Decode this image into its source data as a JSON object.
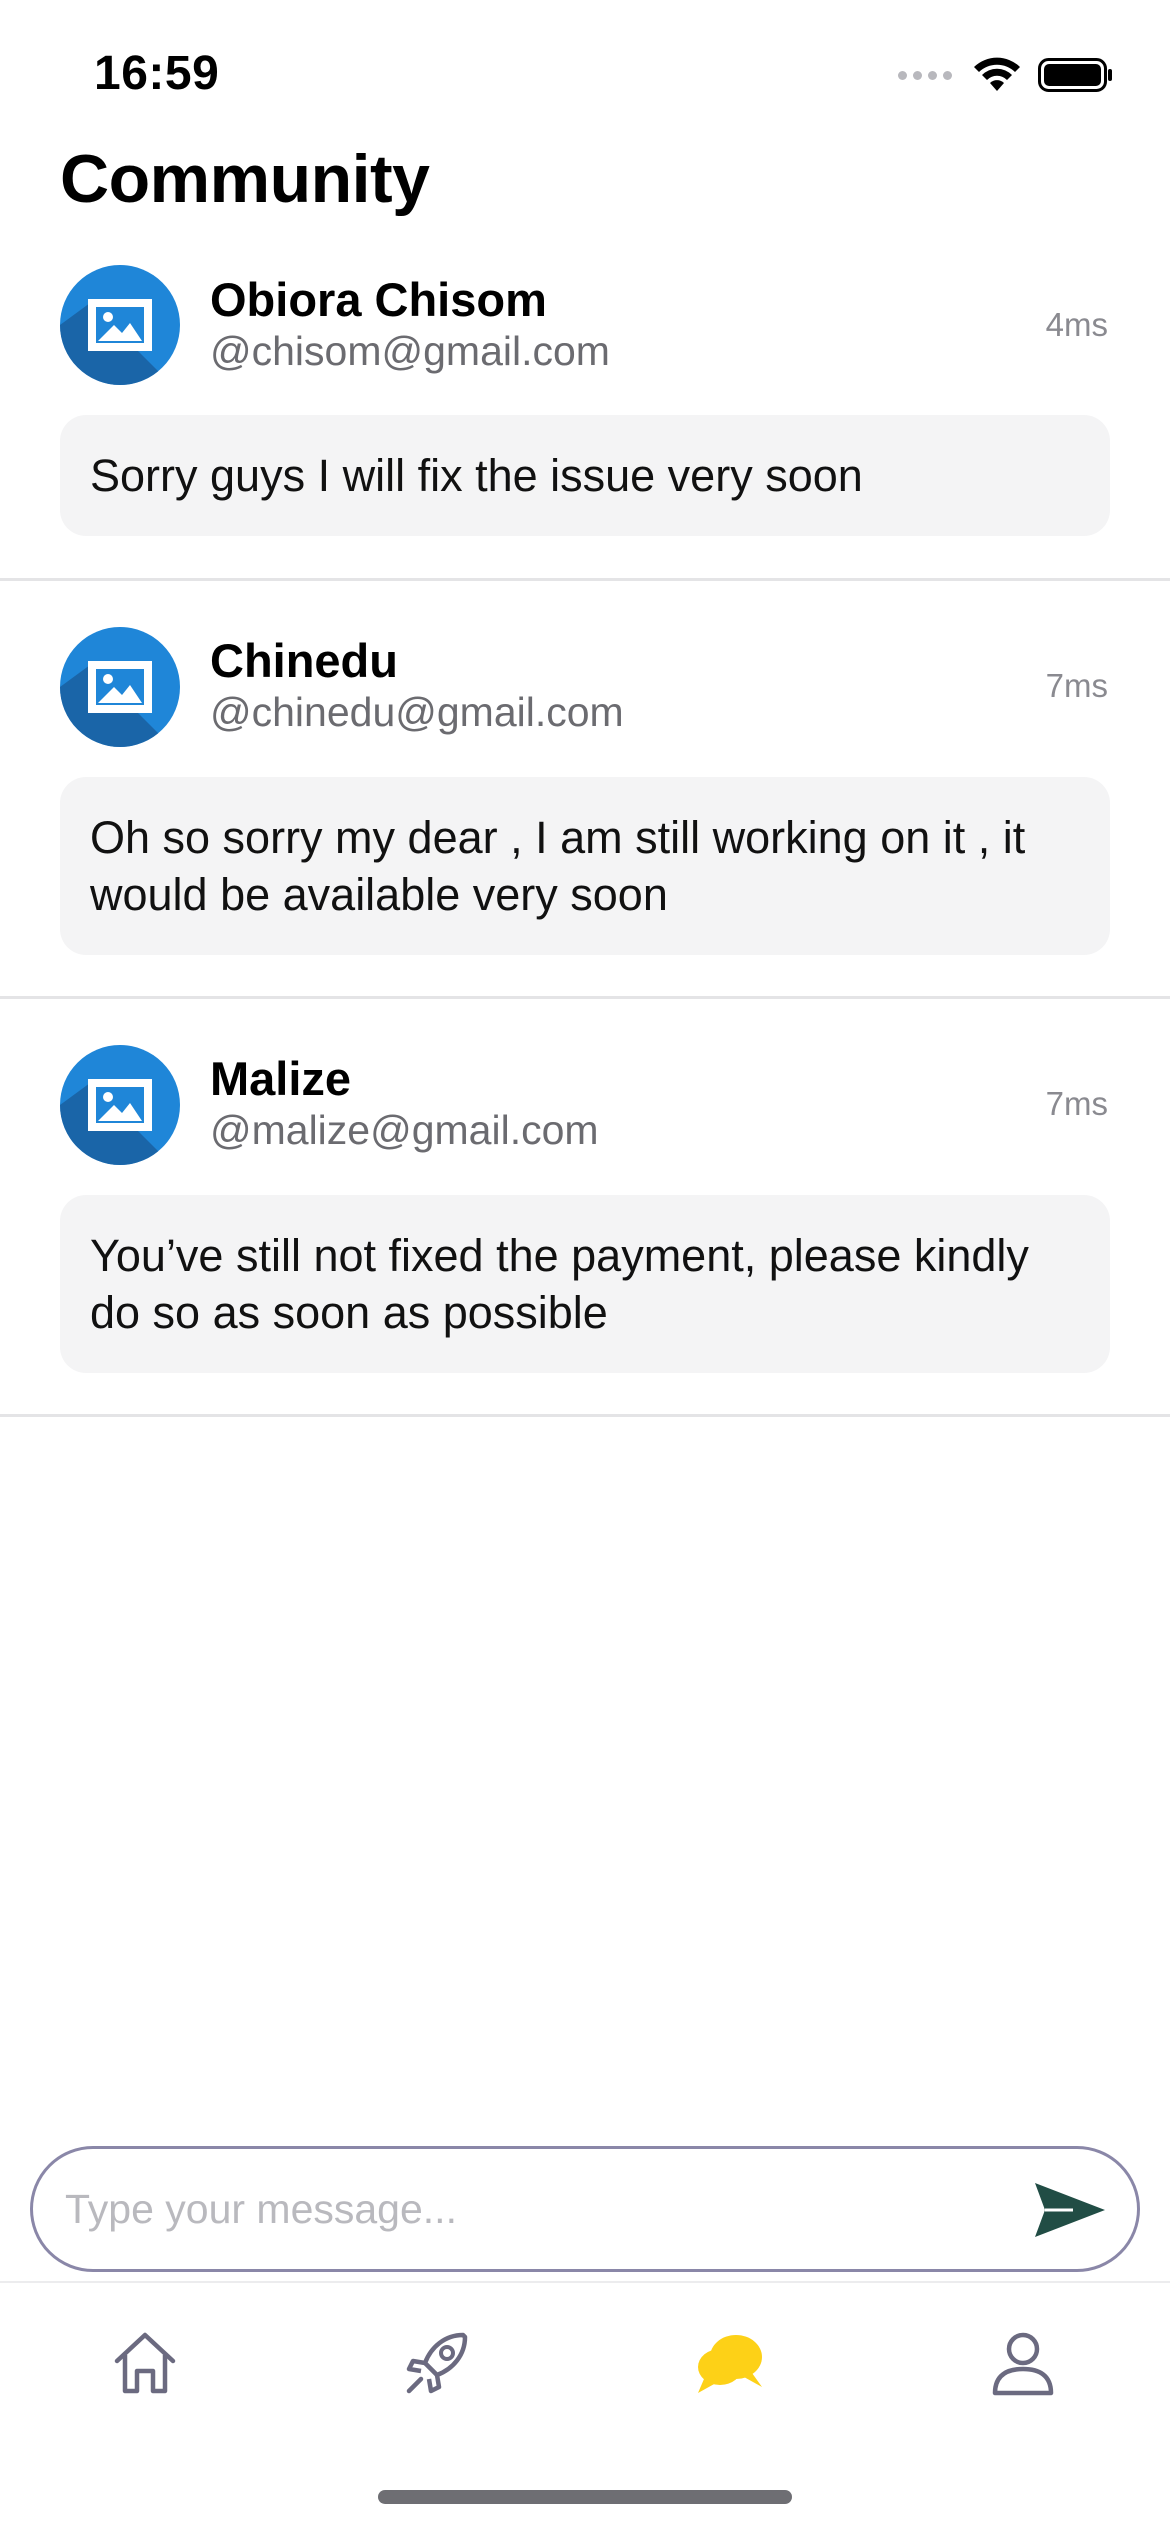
{
  "status_bar": {
    "time": "16:59"
  },
  "page": {
    "title": "Community"
  },
  "posts": [
    {
      "name": "Obiora Chisom",
      "handle": "@chisom@gmail.com",
      "time": "4ms",
      "message": "Sorry guys I will fix the issue very soon"
    },
    {
      "name": "Chinedu",
      "handle": "@chinedu@gmail.com",
      "time": "7ms",
      "message": "Oh so sorry my dear , I am still working on it , it would be available very soon"
    },
    {
      "name": "Malize",
      "handle": "@malize@gmail.com",
      "time": "7ms",
      "message": "You’ve still not fixed the payment, please kindly do so as soon as possible"
    }
  ],
  "composer": {
    "placeholder": "Type your message...",
    "value": ""
  },
  "tab_bar": {
    "items": [
      {
        "icon": "home-icon",
        "active": false
      },
      {
        "icon": "rocket-icon",
        "active": false
      },
      {
        "icon": "chat-icon",
        "active": true
      },
      {
        "icon": "profile-icon",
        "active": false
      }
    ]
  },
  "colors": {
    "avatar_blue": "#1f86d8",
    "active_tab": "#fdd117",
    "inactive_tab": "#6b6a80",
    "send_icon": "#214d45",
    "bubble_bg": "#f4f4f5"
  }
}
